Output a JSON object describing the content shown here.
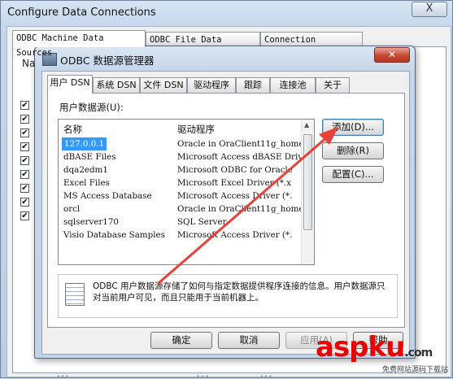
{
  "outer": {
    "title": "Configure Data Connections",
    "close_label": "X",
    "tabs": [
      "ODBC Machine Data Sources",
      "ODBC File Data Sources",
      "Connection Profiles"
    ],
    "column_initial": "Na",
    "checkbox_mark": "✔",
    "footer": [
      "...",
      "...",
      "..."
    ]
  },
  "dialog": {
    "title": "ODBC 数据源管理器",
    "close_label": "✕",
    "tabs": [
      "用户 DSN",
      "系统 DSN",
      "文件 DSN",
      "驱动程序",
      "跟踪",
      "连接池",
      "关于"
    ],
    "active_tab": 0,
    "section_label": "用户数据源(U):",
    "list": {
      "headers": {
        "name": "名称",
        "driver": "驱动程序"
      },
      "rows": [
        {
          "name": "127.0.0.1",
          "driver": "Oracle in OraClient11g_home",
          "selected": true
        },
        {
          "name": "dBASE Files",
          "driver": "Microsoft Access dBASE Driver"
        },
        {
          "name": "dqa2edm1",
          "driver": "Microsoft ODBC for Oracle"
        },
        {
          "name": "Excel Files",
          "driver": "Microsoft Excel Driver (*.x"
        },
        {
          "name": "MS Access Database",
          "driver": "Microsoft Access Driver (*."
        },
        {
          "name": "orcl",
          "driver": "Oracle in OraClient11g_home"
        },
        {
          "name": "sqlserver170",
          "driver": "SQL Server"
        },
        {
          "name": "Visio Database Samples",
          "driver": "Microsoft Access Driver (*."
        }
      ]
    },
    "side_buttons": {
      "add": "添加(D)...",
      "remove": "删除(R)",
      "configure": "配置(C)..."
    },
    "info_text": "ODBC 用户数据源存储了如何与指定数据提供程序连接的信息。用户数据源只对当前用户可见，而且只能用于当前机器上。",
    "bottom_buttons": {
      "ok": "确定",
      "cancel": "取消",
      "apply": "应用(A)",
      "help": "帮助"
    }
  },
  "watermark": {
    "brand": "aspku",
    "suffix": ".com",
    "sub": "免费网站源码下载站"
  },
  "colors": {
    "selection": "#3399ff",
    "arrow": "#e8413a",
    "dialog_close": "#c8482f"
  }
}
